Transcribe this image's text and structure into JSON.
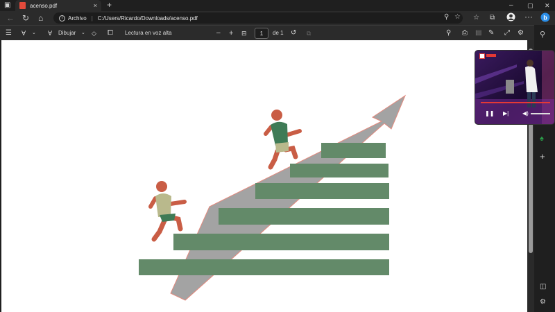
{
  "browser": {
    "tab_title": "acenso.pdf",
    "tab_close": "×",
    "new_tab": "+",
    "window_controls": {
      "minimize": "–",
      "maximize": "▢",
      "close": "✕"
    },
    "url_label": "Archivo",
    "url_path": "C:/Users/Ricardo/Downloads/acenso.pdf"
  },
  "pdf_toolbar": {
    "draw_label": "Dibujar",
    "read_aloud_label": "Lectura en voz alta",
    "zoom_out": "–",
    "zoom_in": "+",
    "page_current": "1",
    "page_total_label": "de 1"
  },
  "icons": {
    "sidebar_toggle": "window-icon",
    "back": "back-arrow-icon",
    "refresh": "refresh-icon",
    "home": "home-icon",
    "bing": "bing-icon"
  },
  "colors": {
    "stair_green": "#638a69",
    "arrow_gray": "#a3a3a3",
    "figure_orange": "#c95d45",
    "shirt_front": "#3f7b56",
    "shirt_back": "#b9b98c",
    "pdf_red": "#e24a3b",
    "bing_blue": "#2b8ee8"
  }
}
